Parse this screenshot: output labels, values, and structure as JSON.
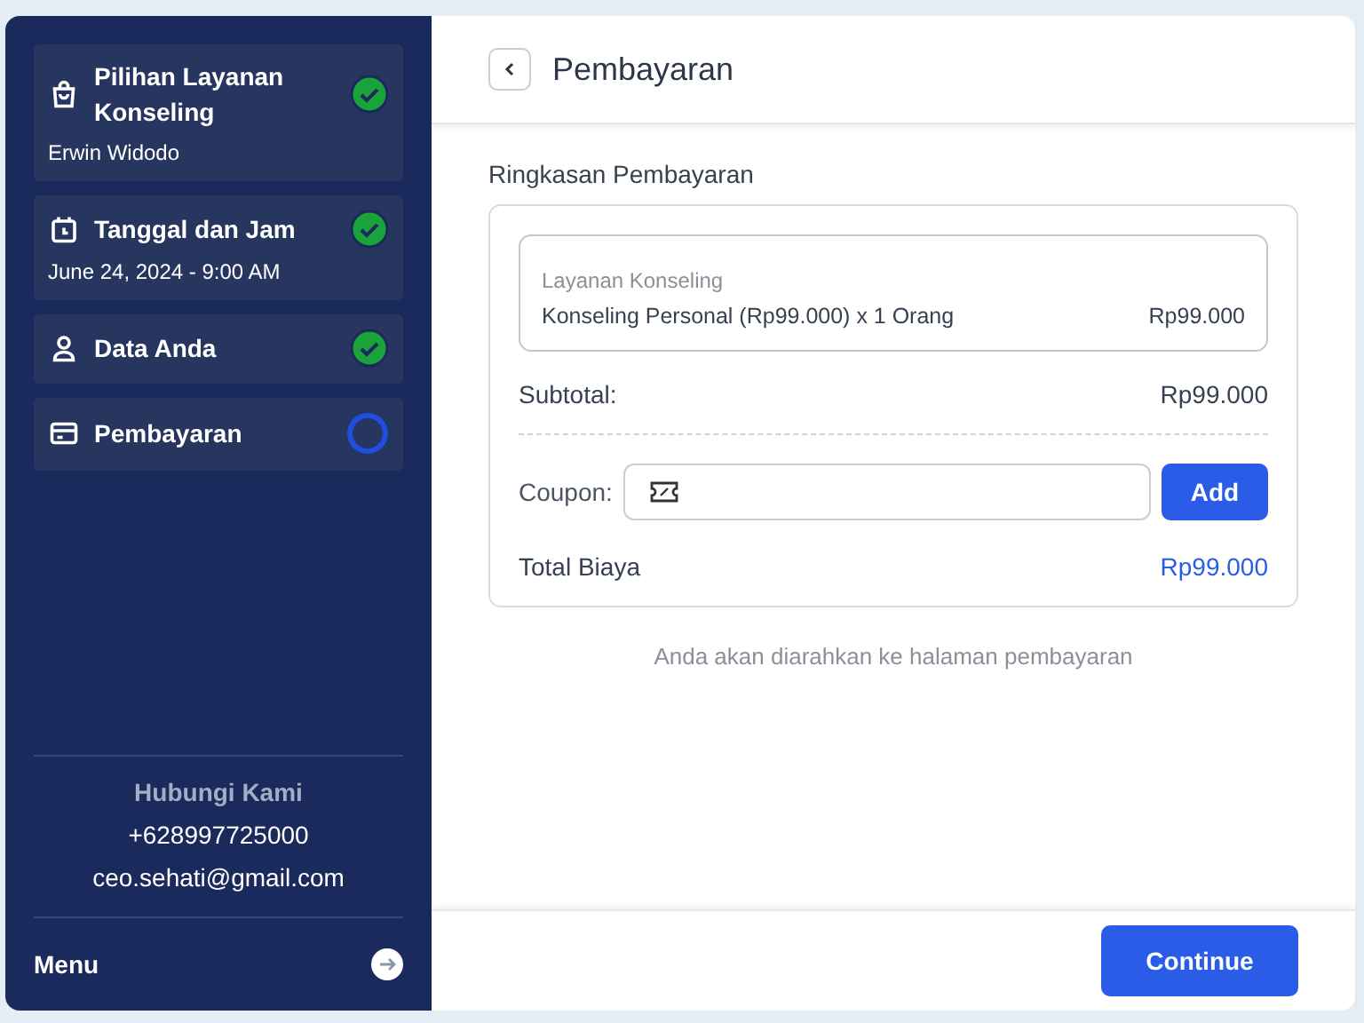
{
  "steps": [
    {
      "kind": "bag",
      "title": "Pilihan Layanan Konseling",
      "subtitle": "Erwin Widodo",
      "done": true
    },
    {
      "kind": "calendar",
      "title": "Tanggal dan Jam",
      "subtitle": "June 24, 2024 - 9:00 AM",
      "done": true
    },
    {
      "kind": "person",
      "title": "Data Anda",
      "done": true
    },
    {
      "kind": "card",
      "title": "Pembayaran",
      "done": false
    }
  ],
  "contact": {
    "heading": "Hubungi Kami",
    "phone": "+628997725000",
    "email": "ceo.sehati@gmail.com"
  },
  "menu": {
    "label": "Menu"
  },
  "header": {
    "title": "Pembayaran"
  },
  "summary": {
    "heading": "Ringkasan Pembayaran",
    "item": {
      "category": "Layanan Konseling",
      "description": "Konseling Personal (Rp99.000) x 1 Orang",
      "price": "Rp99.000"
    },
    "subtotal_label": "Subtotal:",
    "subtotal": "Rp99.000",
    "coupon_label": "Coupon:",
    "coupon_button": "Add",
    "total_label": "Total Biaya",
    "total": "Rp99.000"
  },
  "note": "Anda akan diarahkan ke halaman pembayaran",
  "continue_button": "Continue"
}
